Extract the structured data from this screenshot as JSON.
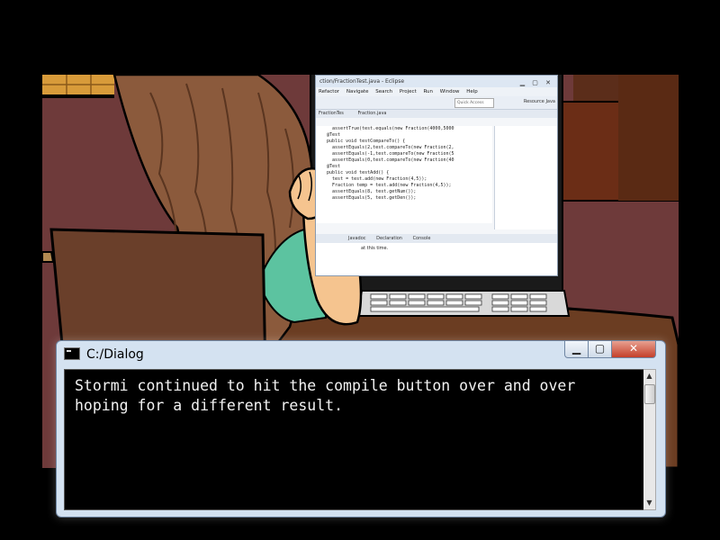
{
  "scene": {
    "colors": {
      "wall": "#6e3a3a",
      "hair": "#8b5a3c",
      "skin": "#f5c48f",
      "shirt": "#5cc3a0",
      "chair": "#6a3f2a",
      "desk": "#6b3d22",
      "window": "#d89b3a"
    },
    "ide": {
      "title": "ction/FractionTest.java - Eclipse",
      "menu": [
        "Refactor",
        "Navigate",
        "Search",
        "Project",
        "Run",
        "Window",
        "Help"
      ],
      "quick_access": "Quick Access",
      "perspectives": [
        "Resource",
        "Java"
      ],
      "tabs": [
        "FractionTes",
        "Fraction.java"
      ],
      "code_lines": [
        "    assertTrue(test.equals(new Fraction(4000,5000",
        "  @Test",
        "  public void testCompareTo() {",
        "    assertEquals(2,test.compareTo(new Fraction(2,",
        "    assertEquals(-1,test.compareTo(new Fraction(5",
        "    assertEquals(0,test.compareTo(new Fraction(40",
        "",
        "  @Test",
        "  public void testAdd() {",
        "    test = test.add(new Fraction(4,5));",
        "",
        "    Fraction temp = test.add(new Fraction(4,5));",
        "    assertEquals(8, test.getNum());",
        "    assertEquals(5, test.getDen());"
      ],
      "console_tabs": [
        "Javadoc",
        "Declaration",
        "Console"
      ],
      "console_text": "at this time."
    }
  },
  "dialog": {
    "title": "C:/Dialog",
    "text": "Stormi continued to hit the compile button over and over\nhoping for a different result.",
    "buttons": {
      "minimize": "▁",
      "maximize": "▢",
      "close": "✕"
    },
    "scroll_up": "▲",
    "scroll_down": "▼"
  }
}
